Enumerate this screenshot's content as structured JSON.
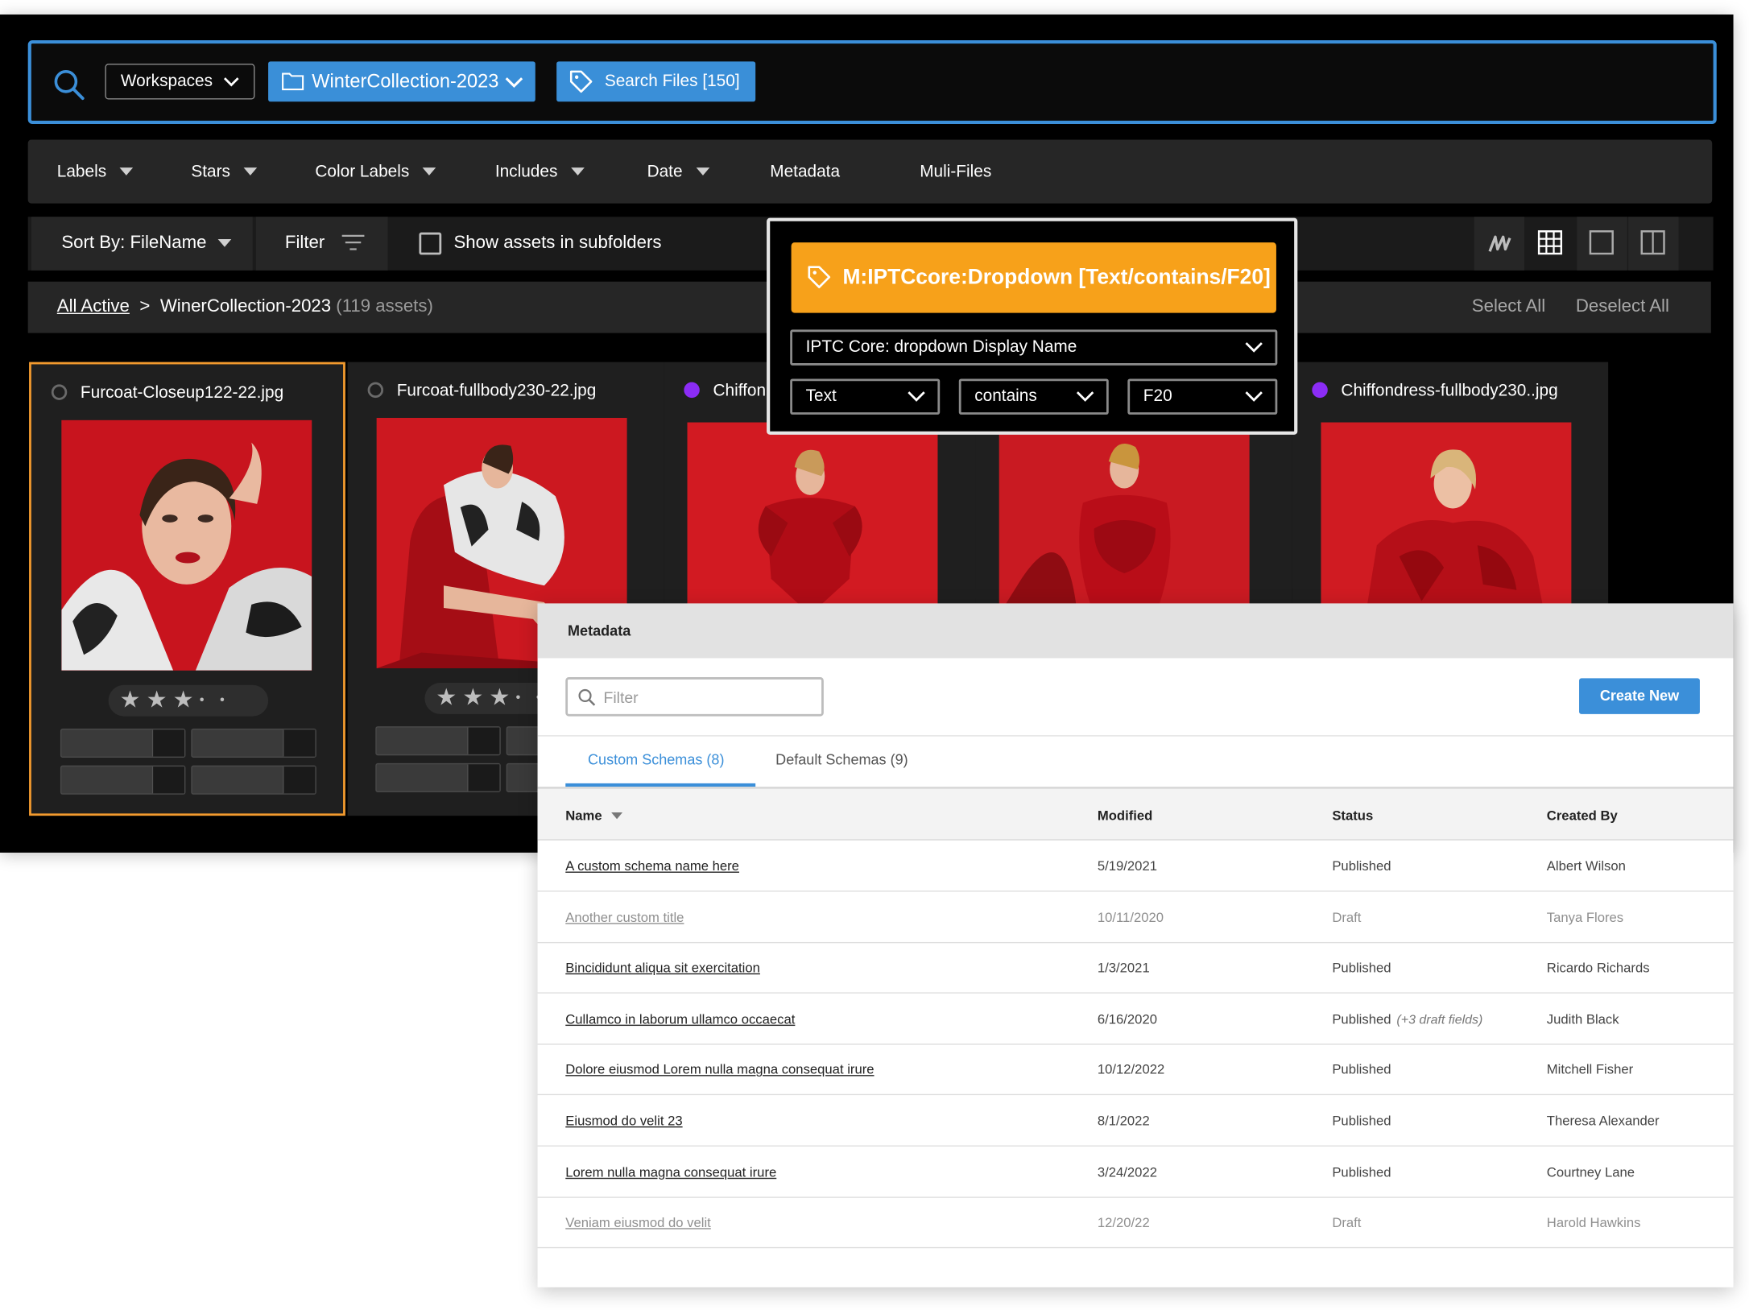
{
  "search": {
    "workspaces_label": "Workspaces",
    "collection_label": "WinterCollection-2023",
    "search_files_label": "Search Files [150]"
  },
  "filters": [
    "Labels",
    "Stars",
    "Color Labels",
    "Includes",
    "Date",
    "Metadata",
    "Muli-Files"
  ],
  "toolbar": {
    "sort_label": "Sort By: FileName",
    "filter_label": "Filter",
    "show_subfolders_label": "Show assets in subfolders"
  },
  "breadcrumb": {
    "root": "All Active",
    "separator": ">",
    "current": "WinerCollection-2023",
    "count": "(119 assets)",
    "select_all": "Select All",
    "deselect_all": "Deselect All"
  },
  "assets": [
    {
      "name": "Furcoat-Closeup122-22.jpg",
      "color_label": "none",
      "selected": true,
      "stars": 3,
      "max_stars": 5
    },
    {
      "name": "Furcoat-fullbody230-22.jpg",
      "color_label": "none",
      "selected": false,
      "stars": 3,
      "max_stars": 5
    },
    {
      "name": "Chiffon",
      "color_label": "#8b2cf5",
      "selected": false
    },
    {
      "name": "",
      "color_label": "none",
      "selected": false
    },
    {
      "name": "Chiffondress-fullbody230..jpg",
      "color_label": "#8b2cf5",
      "selected": false
    }
  ],
  "popup": {
    "title": "M:IPTCcore:Dropdown [Text/contains/F20]",
    "field": "IPTC Core: dropdown Display Name",
    "type": "Text",
    "operator": "contains",
    "value": "F20"
  },
  "metadata": {
    "header": "Metadata",
    "filter_placeholder": "Filter",
    "create_label": "Create New",
    "tabs": [
      "Custom Schemas (8)",
      "Default Schemas (9)"
    ],
    "columns": [
      "Name",
      "Modified",
      "Status",
      "Created By"
    ],
    "rows": [
      {
        "name": "A custom schema name here",
        "modified": "5/19/2021",
        "status": "Published",
        "note": "",
        "created_by": "Albert Wilson",
        "draft": false
      },
      {
        "name": "Another custom title",
        "modified": "10/11/2020",
        "status": "Draft",
        "note": "",
        "created_by": "Tanya Flores",
        "draft": true
      },
      {
        "name": "Bincididunt aliqua sit exercitation",
        "modified": "1/3/2021",
        "status": "Published",
        "note": "",
        "created_by": "Ricardo Richards",
        "draft": false
      },
      {
        "name": "Cullamco in laborum ullamco occaecat",
        "modified": "6/16/2020",
        "status": "Published",
        "note": "(+3 draft fields)",
        "created_by": "Judith Black",
        "draft": false
      },
      {
        "name": "Dolore eiusmod Lorem nulla magna consequat irure",
        "modified": "10/12/2022",
        "status": "Published",
        "note": "",
        "created_by": "Mitchell Fisher",
        "draft": false
      },
      {
        "name": "Eiusmod do velit 23",
        "modified": "8/1/2022",
        "status": "Published",
        "note": "",
        "created_by": "Theresa Alexander",
        "draft": false
      },
      {
        "name": "Lorem nulla magna consequat irure",
        "modified": "3/24/2022",
        "status": "Published",
        "note": "",
        "created_by": "Courtney Lane",
        "draft": false
      },
      {
        "name": "Veniam eiusmod do velit",
        "modified": "12/20/22",
        "status": "Draft",
        "note": "",
        "created_by": "Harold Hawkins",
        "draft": true
      }
    ]
  },
  "colors": {
    "accent_blue": "#3b8fd9",
    "selection_orange": "#f29a2e",
    "popup_orange": "#f7a11a",
    "purple_label": "#8b2cf5"
  }
}
